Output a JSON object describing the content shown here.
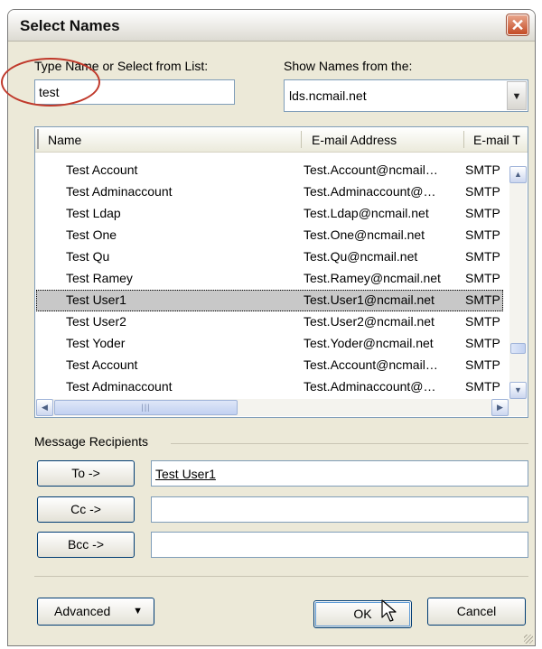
{
  "window": {
    "title": "Select Names"
  },
  "search": {
    "label": "Type Name or Select from List:",
    "value": "test"
  },
  "source": {
    "label": "Show Names from the:",
    "selected": "lds.ncmail.net"
  },
  "list": {
    "columns": [
      "Name",
      "E-mail Address",
      "E-mail T"
    ],
    "rows": [
      {
        "name": "Test Account",
        "email": "Test.Account@ncmail…",
        "type": "SMTP"
      },
      {
        "name": "Test Adminaccount",
        "email": "Test.Adminaccount@…",
        "type": "SMTP"
      },
      {
        "name": "Test Ldap",
        "email": "Test.Ldap@ncmail.net",
        "type": "SMTP"
      },
      {
        "name": "Test One",
        "email": "Test.One@ncmail.net",
        "type": "SMTP"
      },
      {
        "name": "Test Qu",
        "email": "Test.Qu@ncmail.net",
        "type": "SMTP"
      },
      {
        "name": "Test Ramey",
        "email": "Test.Ramey@ncmail.net",
        "type": "SMTP"
      },
      {
        "name": "Test User1",
        "email": "Test.User1@ncmail.net",
        "type": "SMTP"
      },
      {
        "name": "Test User2",
        "email": "Test.User2@ncmail.net",
        "type": "SMTP"
      },
      {
        "name": "Test Yoder",
        "email": "Test.Yoder@ncmail.net",
        "type": "SMTP"
      },
      {
        "name": "Test Account",
        "email": "Test.Account@ncmail…",
        "type": "SMTP"
      },
      {
        "name": "Test Adminaccount",
        "email": "Test.Adminaccount@…",
        "type": "SMTP"
      }
    ],
    "selected_row": "Test User1"
  },
  "recipients": {
    "group_label": "Message Recipients",
    "to_label": "To ->",
    "to_value": "Test User1",
    "cc_label": "Cc ->",
    "cc_value": "",
    "bcc_label": "Bcc ->",
    "bcc_value": ""
  },
  "footer": {
    "advanced_label": "Advanced",
    "ok_label": "OK",
    "cancel_label": "Cancel"
  },
  "colors": {
    "annotation": "#c0392b",
    "close_button": "#c44b26",
    "selection": "#c8c8c8"
  },
  "icons": [
    "close-icon",
    "chevron-down-icon",
    "scroll-up-icon",
    "scroll-down-icon",
    "scroll-left-icon",
    "scroll-right-icon",
    "mouse-pointer-icon"
  ]
}
